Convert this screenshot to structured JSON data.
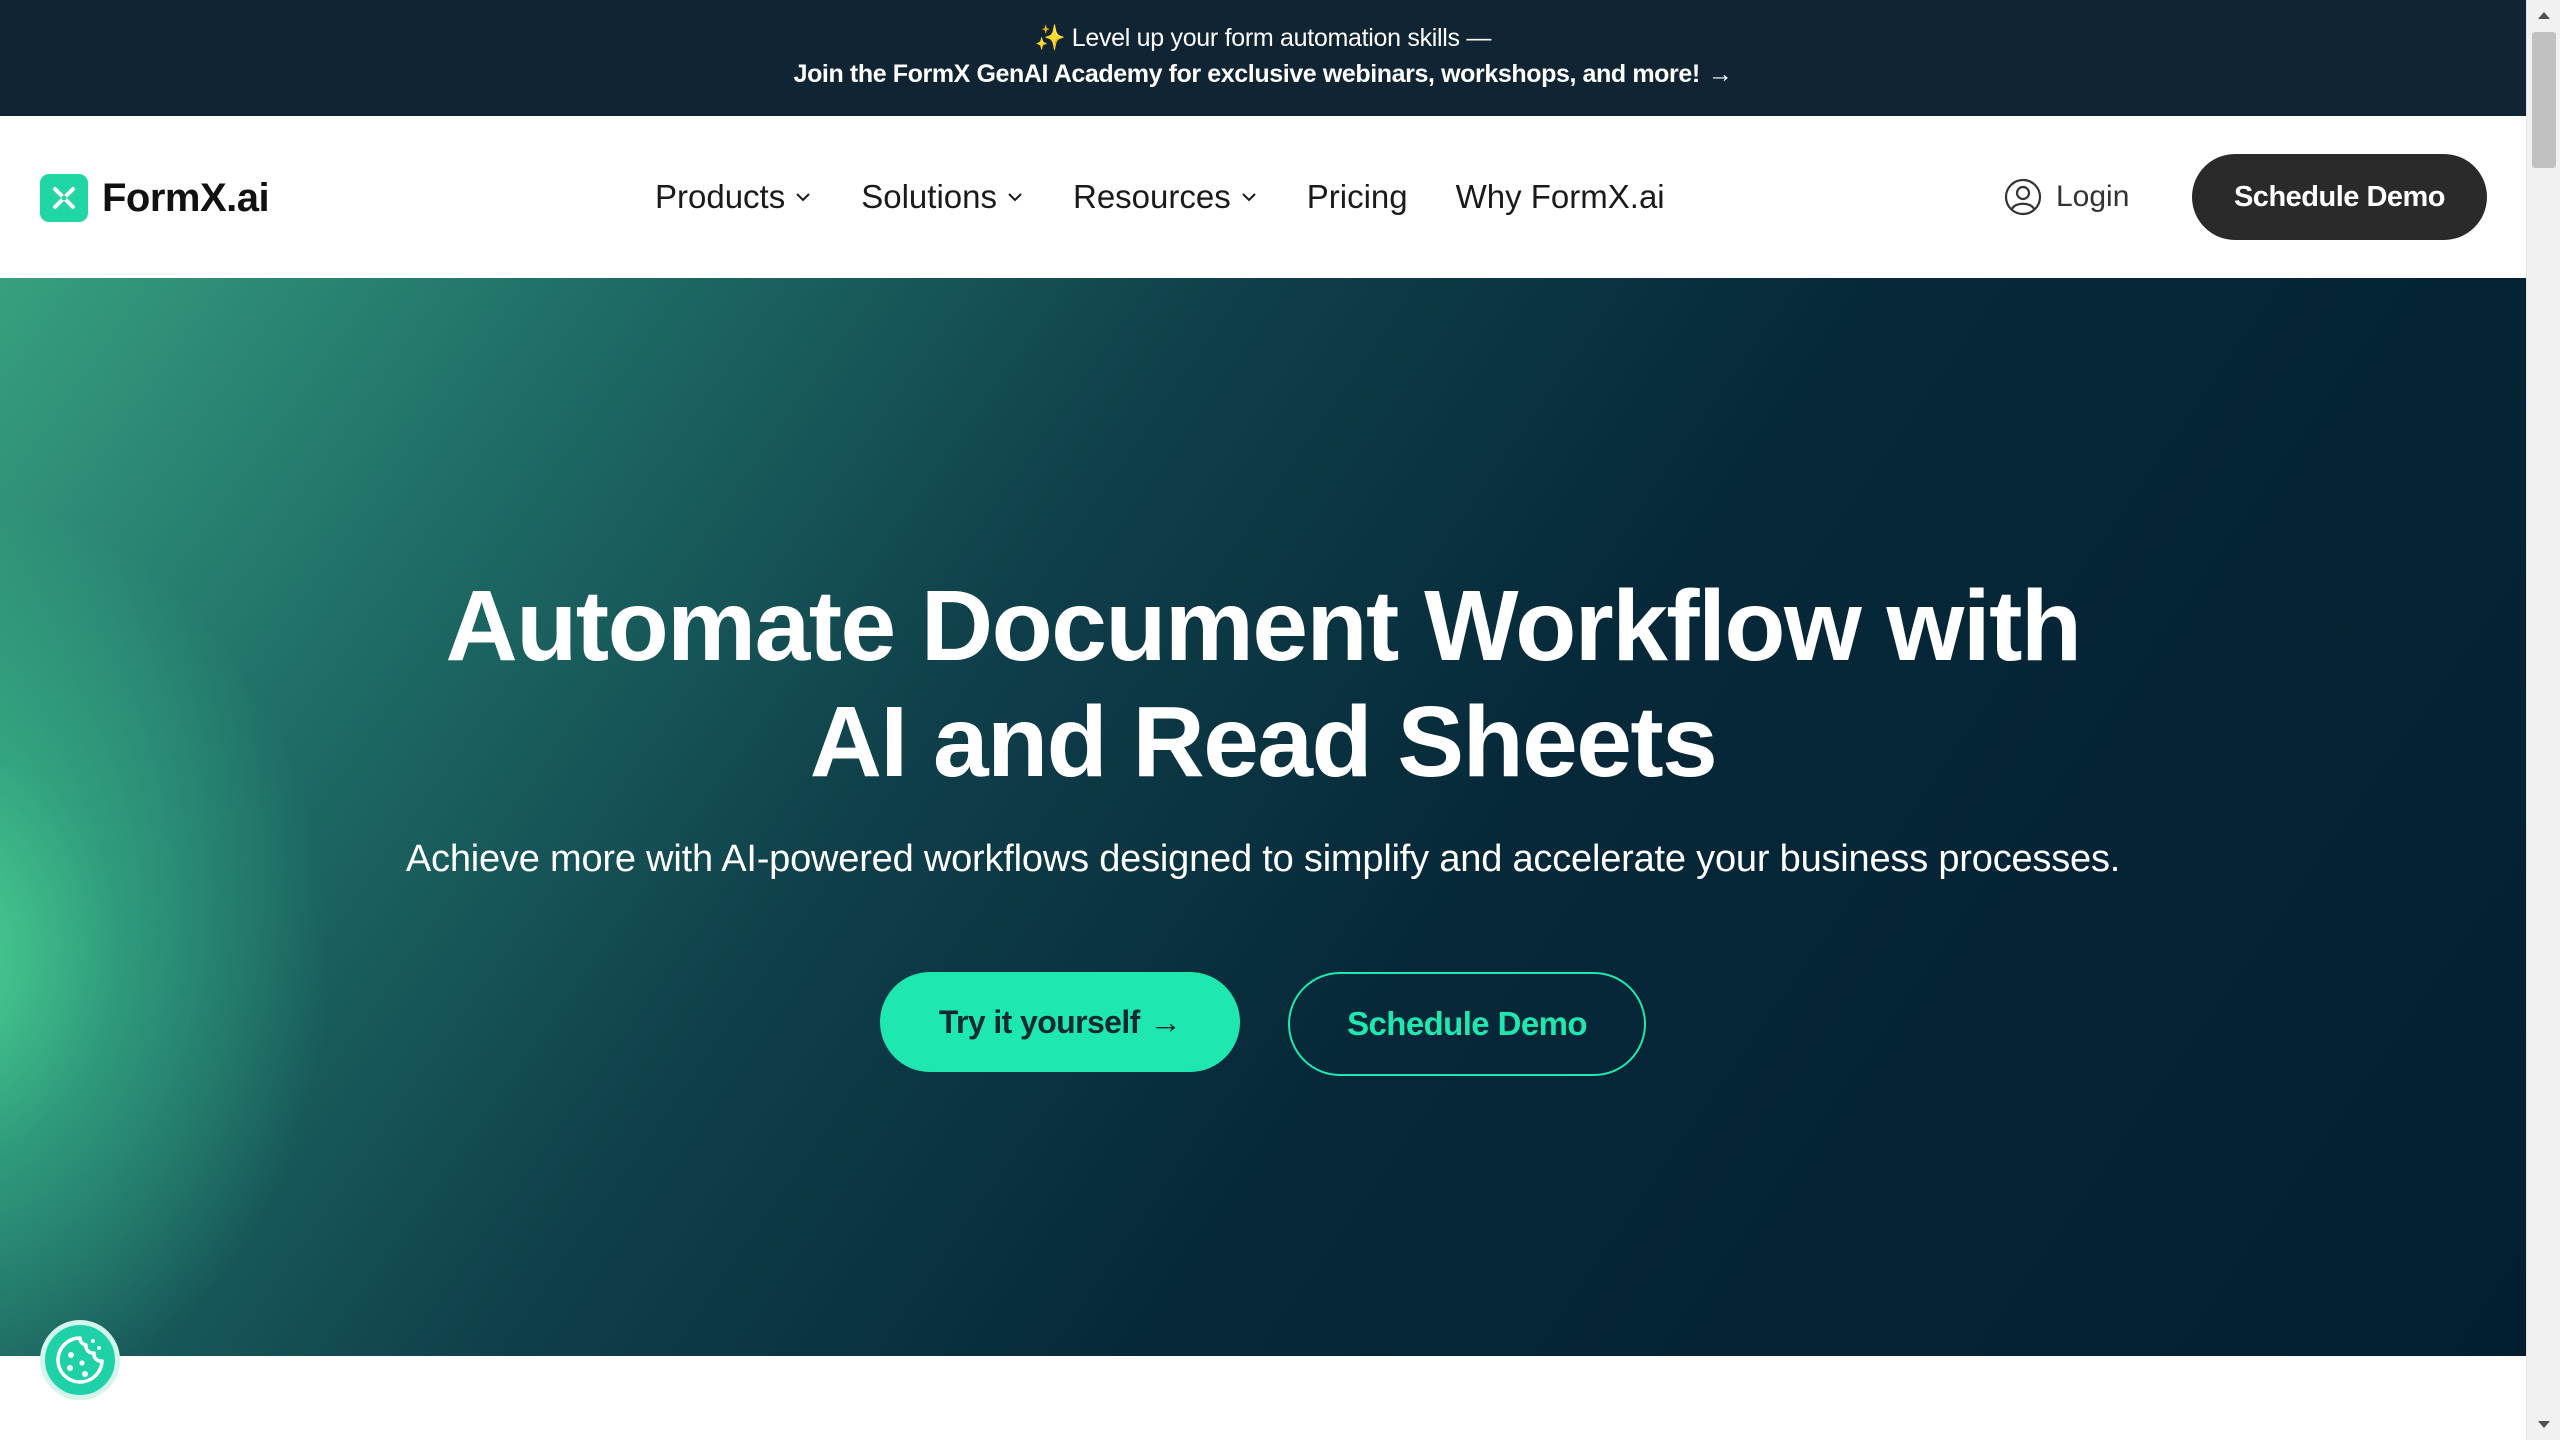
{
  "announcement": {
    "sparkle": "✨",
    "line1": "Level up your form automation skills —",
    "line2": "Join the FormX GenAI Academy for exclusive webinars, workshops, and more!",
    "arrow": "→"
  },
  "nav": {
    "logo_text": "FormX.ai",
    "items": [
      {
        "label": "Products",
        "dropdown": true
      },
      {
        "label": "Solutions",
        "dropdown": true
      },
      {
        "label": "Resources",
        "dropdown": true
      },
      {
        "label": "Pricing",
        "dropdown": false
      },
      {
        "label": "Why FormX.ai",
        "dropdown": false
      }
    ],
    "login_label": "Login",
    "demo_label": "Schedule Demo"
  },
  "hero": {
    "title_line1": "Automate Document Workflow with",
    "title_line2": "AI and Read Sheets",
    "subtitle": "Achieve more with AI-powered workflows designed to simplify and accelerate your business processes.",
    "try_label": "Try it yourself",
    "try_arrow": "→",
    "demo_label": "Schedule Demo"
  },
  "colors": {
    "announce_bg": "#112433",
    "brand_green": "#1fd6a4",
    "cta_green": "#1ee8b0",
    "hero_dark": "#021f31",
    "nav_button": "#2a2a2a"
  },
  "icons": {
    "logo": "formx-logo-icon",
    "chevron": "chevron-down-icon",
    "user": "user-circle-icon",
    "cookie": "cookie-icon"
  }
}
